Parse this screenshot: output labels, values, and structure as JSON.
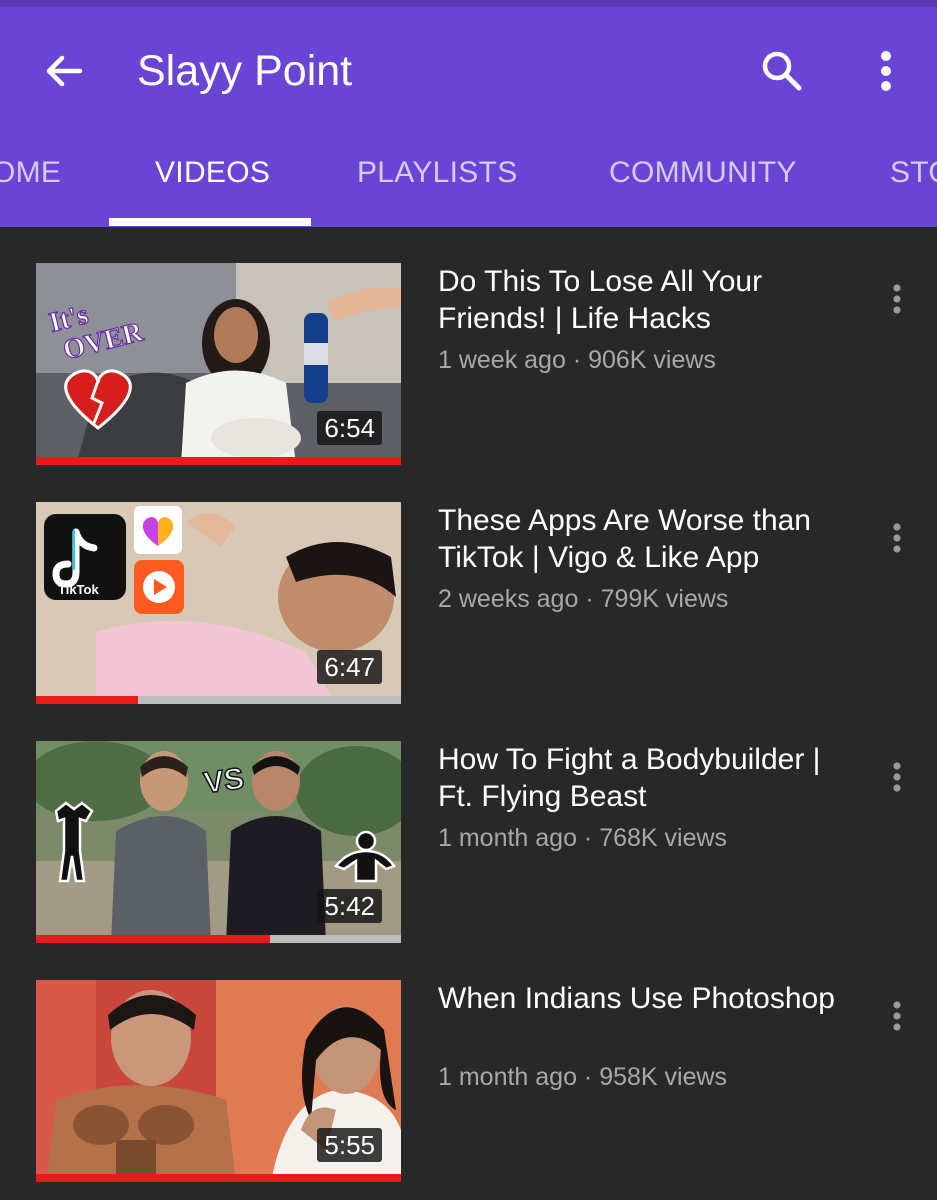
{
  "app": {
    "channel_title": "Slayy Point",
    "icons": {
      "back": "back-arrow-icon",
      "search": "search-icon",
      "more": "more-vertical-icon"
    },
    "colors": {
      "header": "#6a44d4",
      "background": "#282828",
      "progress": "#e81a1a"
    }
  },
  "tabs": [
    {
      "label": "OME",
      "active": false
    },
    {
      "label": "VIDEOS",
      "active": true
    },
    {
      "label": "PLAYLISTS",
      "active": false
    },
    {
      "label": "COMMUNITY",
      "active": false
    },
    {
      "label": "STO",
      "active": false
    }
  ],
  "videos": [
    {
      "title": "Do This To Lose All Your Friends! | Life Hacks",
      "meta": "1 week ago · 906K views",
      "duration": "6:54",
      "watched_fraction": 1.0,
      "thumb_text": [
        "It's",
        "OVER"
      ]
    },
    {
      "title": "These Apps Are Worse than TikTok | Vigo & Like App",
      "meta": "2 weeks ago · 799K views",
      "duration": "6:47",
      "watched_fraction": 0.28,
      "thumb_text": [
        "TikTok"
      ]
    },
    {
      "title": "How To Fight a Bodybuilder | Ft. Flying Beast",
      "meta": "1 month ago · 768K views",
      "duration": "5:42",
      "watched_fraction": 0.64,
      "thumb_text": [
        "VS"
      ]
    },
    {
      "title": "When Indians Use Photoshop",
      "meta": "1 month ago · 958K views",
      "duration": "5:55",
      "watched_fraction": 1.0,
      "thumb_text": []
    }
  ]
}
